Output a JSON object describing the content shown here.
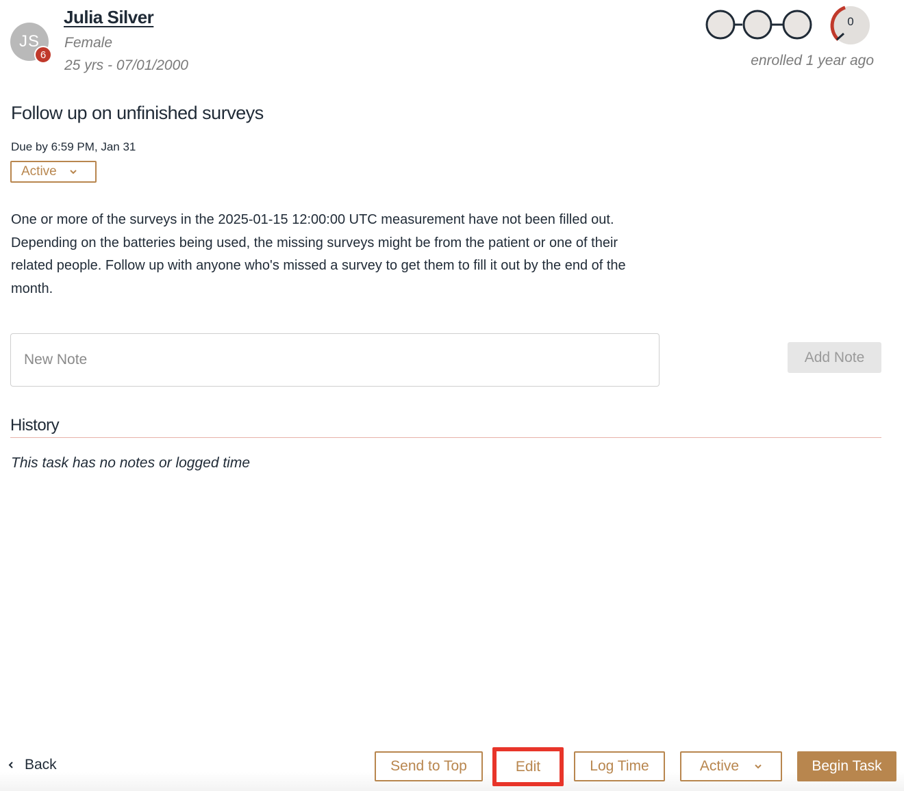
{
  "patient": {
    "initials": "JS",
    "badge_count": "6",
    "name": "Julia Silver",
    "gender": "Female",
    "age_dob": "25 yrs - 07/01/2000",
    "enrolled": "enrolled 1 year ago",
    "score": "0",
    "progress_steps": 3,
    "colors": {
      "avatar": "#b9b9b9",
      "badge": "#c0392b",
      "score_arc": "#c0392b"
    }
  },
  "task": {
    "title": "Follow up on unfinished surveys",
    "due": "Due by 6:59 PM, Jan 31",
    "status": "Active",
    "description": "One or more of the surveys in the 2025-01-15 12:00:00 UTC measurement have not been filled out. Depending on the batteries being used, the missing surveys might be from the patient or one of their related people. Follow up with anyone who's missed a survey to get them to fill it out by the end of the month."
  },
  "note": {
    "placeholder": "New Note",
    "value": "",
    "add_label": "Add Note"
  },
  "history": {
    "title": "History",
    "empty_text": "This task has no notes or logged time"
  },
  "footer": {
    "back_label": "Back",
    "send_to_top_label": "Send to Top",
    "edit_label": "Edit",
    "log_time_label": "Log Time",
    "status_label": "Active",
    "begin_label": "Begin Task"
  },
  "colors": {
    "accent": "#b8864e",
    "text": "#1f2a36",
    "muted": "#7a7a7a",
    "highlight": "#e8352a",
    "history_rule": "#e7b1a8"
  }
}
